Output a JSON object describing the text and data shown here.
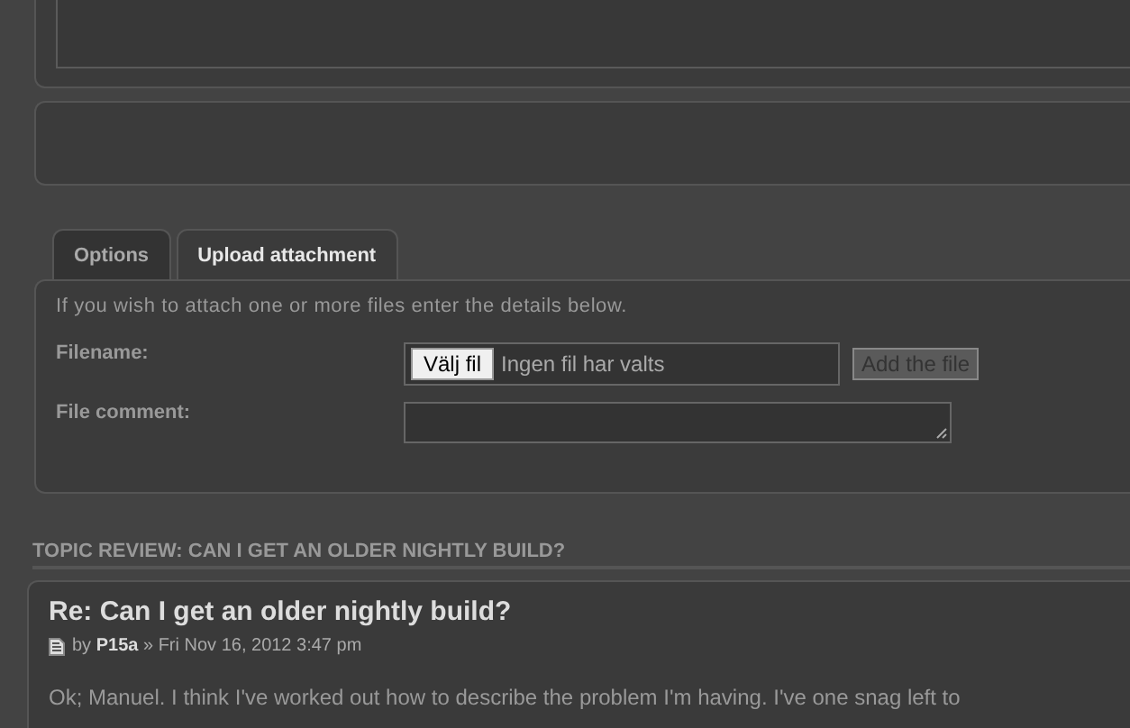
{
  "tabs": [
    {
      "label": "Options",
      "selected": false
    },
    {
      "label": "Upload attachment",
      "selected": true
    }
  ],
  "upload": {
    "intro": "If you wish to attach one or more files enter the details below.",
    "filename_label": "Filename:",
    "choose_button": "Välj fil",
    "no_file": "Ingen fil har valts",
    "add_button": "Add the file",
    "add_disabled": true,
    "comment_label": "File comment:"
  },
  "topic_review": {
    "heading": "TOPIC REVIEW: CAN I GET AN OLDER NIGHTLY BUILD?",
    "post": {
      "title": "Re: Can I get an older nightly build?",
      "meta": "by **P15a** » Fri Nov 16, 2012 3:47 pm",
      "body": "Ok; Manuel. I think I've worked out how to describe the problem I'm having. I've one snag left to"
    }
  }
}
